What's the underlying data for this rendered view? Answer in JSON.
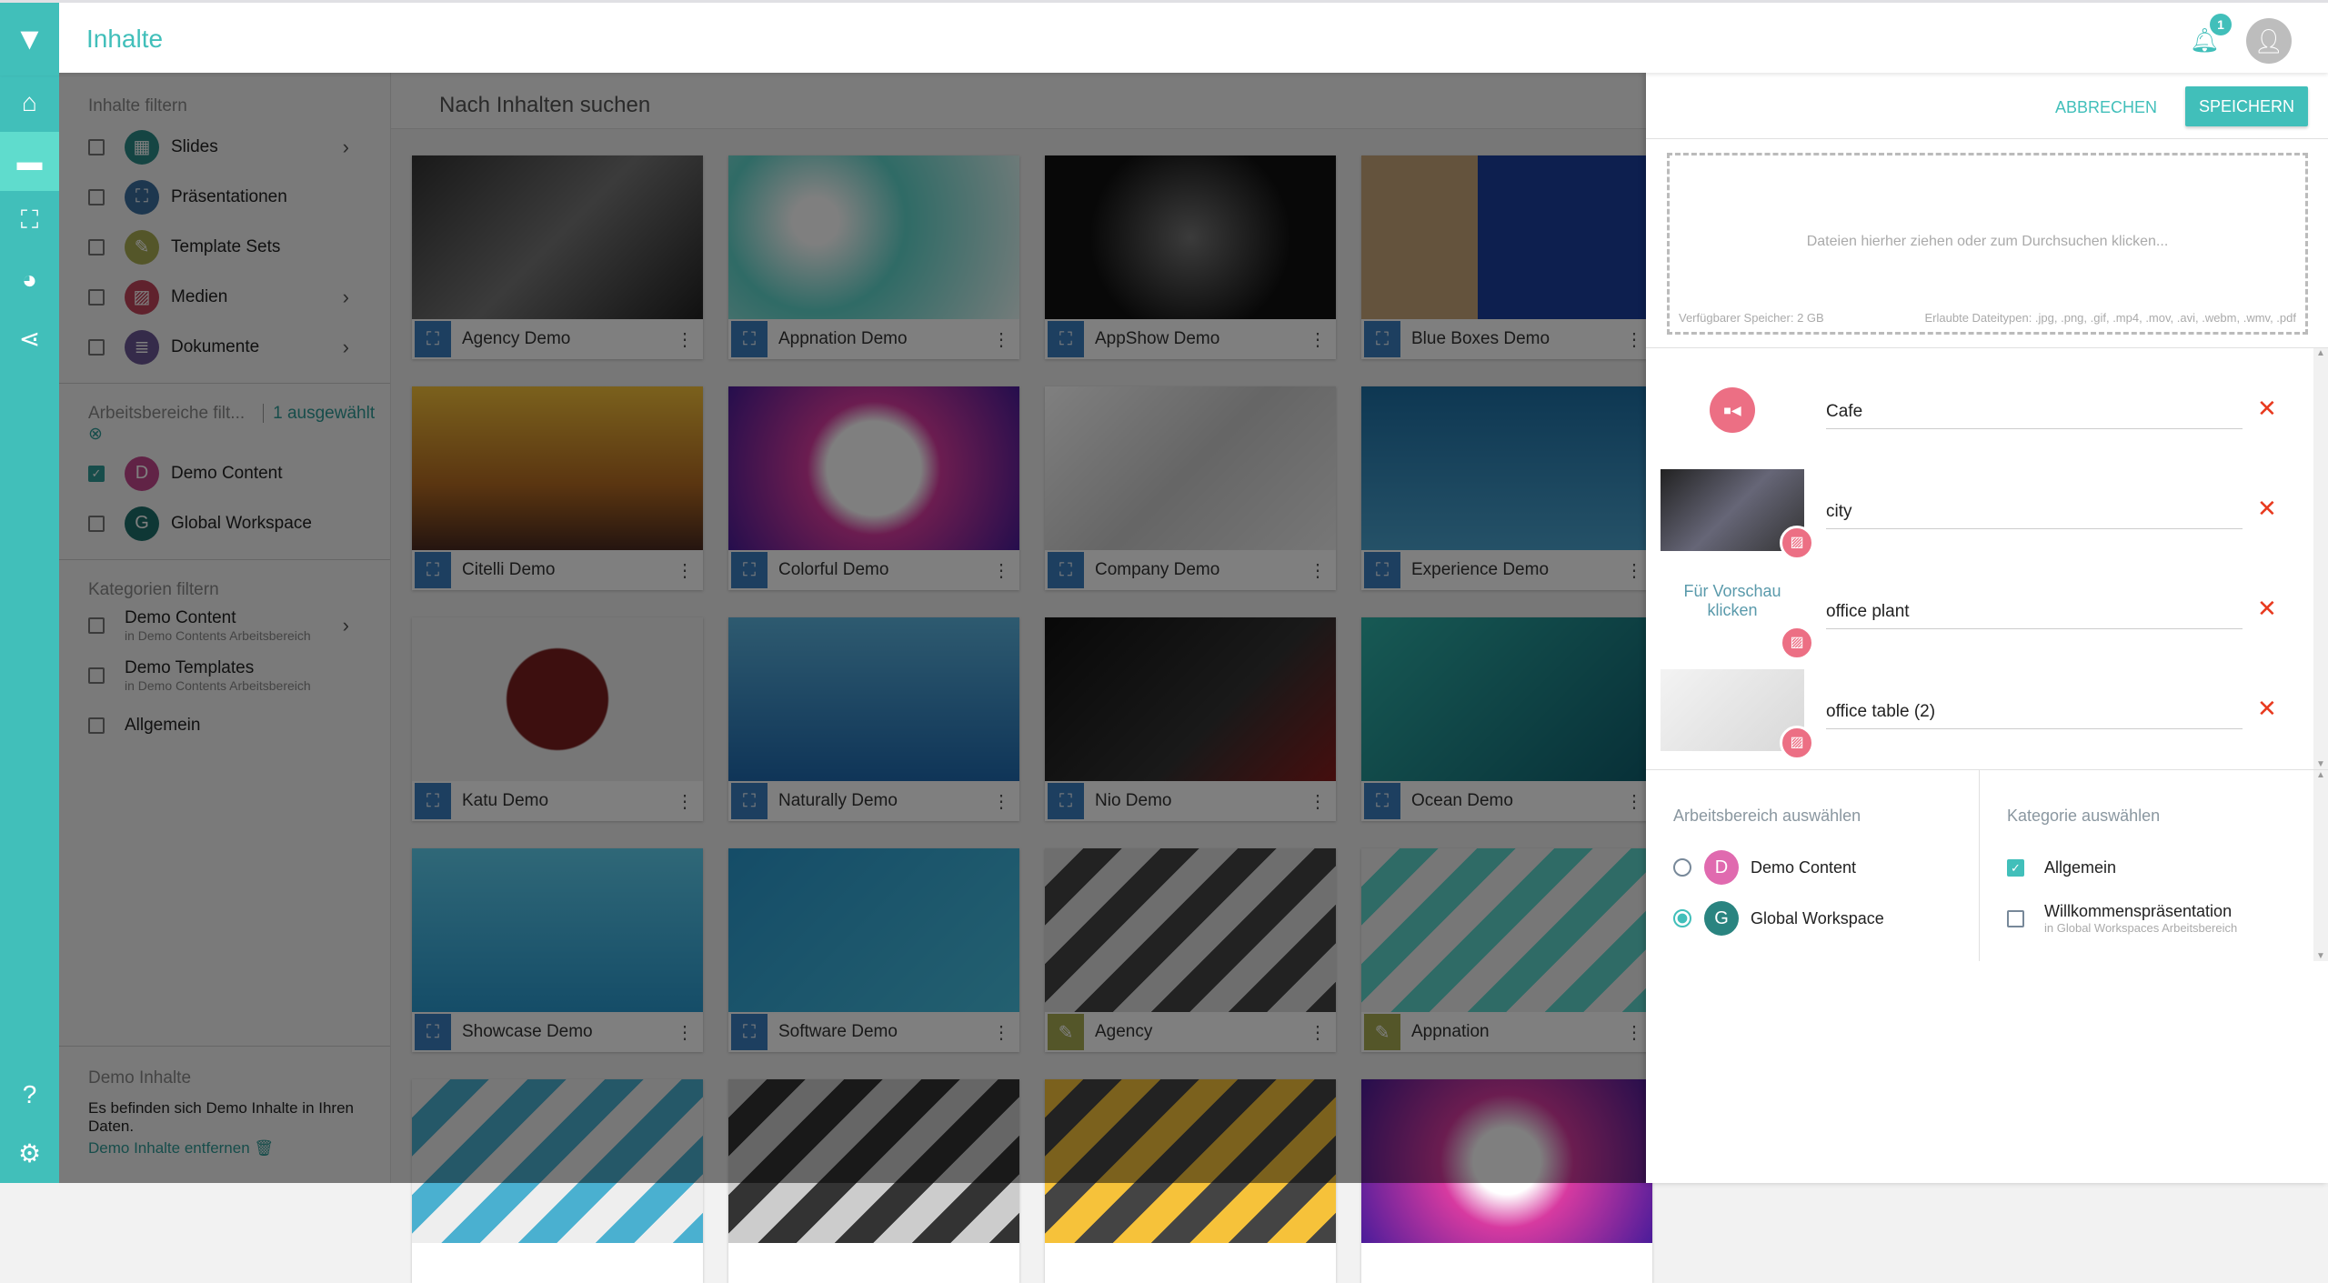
{
  "header": {
    "title": "Inhalte",
    "notification_count": "1"
  },
  "rail": [
    "home-icon",
    "folder-icon",
    "presentation-clock-icon",
    "pie-chart-icon",
    "share-clock-icon"
  ],
  "filters": {
    "content_title": "Inhalte filtern",
    "content_types": [
      {
        "label": "Slides",
        "color": "#2a8b87",
        "icon": "▦",
        "chevron": true
      },
      {
        "label": "Präsentationen",
        "color": "#3a6e9e",
        "icon": "⛶",
        "chevron": false
      },
      {
        "label": "Template Sets",
        "color": "#a9ad53",
        "icon": "✎",
        "chevron": false
      },
      {
        "label": "Medien",
        "color": "#c0455a",
        "icon": "▨",
        "chevron": true
      },
      {
        "label": "Dokumente",
        "color": "#6a5694",
        "icon": "≣",
        "chevron": true
      }
    ],
    "workspace_title": "Arbeitsbereiche filt...",
    "workspace_selected": "1 ausgewählt",
    "workspaces": [
      {
        "label": "Demo Content",
        "letter": "D",
        "color": "#c2478c",
        "checked": true
      },
      {
        "label": "Global Workspace",
        "letter": "G",
        "color": "#1d6e6a",
        "checked": false
      }
    ],
    "category_title": "Kategorien filtern",
    "categories": [
      {
        "label": "Demo Content",
        "sub": "in Demo Contents Arbeitsbereich",
        "chevron": true
      },
      {
        "label": "Demo Templates",
        "sub": "in Demo Contents Arbeitsbereich",
        "chevron": false
      },
      {
        "label": "Allgemein",
        "sub": "",
        "chevron": false
      }
    ],
    "demo_title": "Demo Inhalte",
    "demo_text": "Es befinden sich Demo Inhalte in Ihren Daten.",
    "demo_remove": "Demo Inhalte entfernen"
  },
  "search": {
    "placeholder": "Nach Inhalten suchen"
  },
  "cards": [
    {
      "name": "Agency Demo",
      "type": "presentation",
      "bg": "linear-gradient(135deg,#333,#777 50%,#222)"
    },
    {
      "name": "Appnation Demo",
      "type": "presentation",
      "bg": "radial-gradient(circle at 30% 40%,#fff 10%,#5fd6cc 40%,#e8f8f6)"
    },
    {
      "name": "AppShow Demo",
      "type": "presentation",
      "bg": "radial-gradient(circle,#777,#111 60%)"
    },
    {
      "name": "Blue Boxes Demo",
      "type": "presentation",
      "bg": "linear-gradient(90deg,#c9a77a 40%,#1a3f9e 40%)"
    },
    {
      "name": "Citelli Demo",
      "type": "presentation",
      "bg": "linear-gradient(180deg,#f6c23a,#b56b22 60%,#4a2a20)"
    },
    {
      "name": "Colorful Demo",
      "type": "presentation",
      "bg": "radial-gradient(circle,#fff 28%,#d73aa0 40%,#4a1c9a)"
    },
    {
      "name": "Company Demo",
      "type": "presentation",
      "bg": "linear-gradient(135deg,#fff,#ccc 50%,#eee)"
    },
    {
      "name": "Experience Demo",
      "type": "presentation",
      "bg": "linear-gradient(180deg,#1c6fa5,#4aa3cf)"
    },
    {
      "name": "Katu Demo",
      "type": "presentation",
      "bg": "radial-gradient(circle,#7a1f1f 30%,#eee 31%)"
    },
    {
      "name": "Naturally Demo",
      "type": "presentation",
      "bg": "linear-gradient(180deg,#5cb5e0,#1f6ab0)"
    },
    {
      "name": "Nio Demo",
      "type": "presentation",
      "bg": "linear-gradient(135deg,#111,#333 60%,#8a1c1c)"
    },
    {
      "name": "Ocean Demo",
      "type": "presentation",
      "bg": "linear-gradient(135deg,#2fb3a9,#0f5f6f)"
    },
    {
      "name": "Showcase Demo",
      "type": "presentation",
      "bg": "linear-gradient(180deg,#5fd0f0,#2a9ad0)"
    },
    {
      "name": "Software Demo",
      "type": "presentation",
      "bg": "linear-gradient(135deg,#2a9ad0,#47c0e0)"
    },
    {
      "name": "Agency",
      "type": "template",
      "bg": "repeating-linear-gradient(135deg,#ddd 0 30px,#444 30px 60px)"
    },
    {
      "name": "Appnation",
      "type": "template",
      "bg": "repeating-linear-gradient(135deg,#eee 0 30px,#5fd6cc 30px 60px)"
    },
    {
      "name": "",
      "type": "",
      "bg": "repeating-linear-gradient(135deg,#eee 0 30px,#4ab0d0 30px 60px)"
    },
    {
      "name": "",
      "type": "",
      "bg": "repeating-linear-gradient(135deg,#ccc 0 30px,#333 30px 60px)"
    },
    {
      "name": "",
      "type": "",
      "bg": "repeating-linear-gradient(135deg,#f6c23a 0 30px,#444 30px 60px)"
    },
    {
      "name": "",
      "type": "",
      "bg": "radial-gradient(circle,#fff 20%,#d73aa0 40%,#4a1c9a)"
    }
  ],
  "panel": {
    "cancel": "ABBRECHEN",
    "save": "SPEICHERN",
    "drop_text": "Dateien hierher ziehen oder zum Durchsuchen klicken...",
    "storage": "Verfügbarer Speicher: 2 GB",
    "types": "Erlaubte Dateitypen: .jpg, .png, .gif, .mp4, .mov, .avi, .webm, .wmv, .pdf",
    "uploads": [
      {
        "name": "Cafe",
        "kind": "video",
        "preview": ""
      },
      {
        "name": "city",
        "kind": "image",
        "preview": "linear-gradient(135deg,#222,#667 50%,#333)"
      },
      {
        "name": "office plant",
        "kind": "image",
        "preview": "",
        "preview_text": "Für Vorschau klicken"
      },
      {
        "name": "office table (2)",
        "kind": "image",
        "preview": "linear-gradient(135deg,#f3f3f3,#d8d8d8)"
      }
    ],
    "workspace_title": "Arbeitsbereich auswählen",
    "workspaces": [
      {
        "label": "Demo Content",
        "letter": "D",
        "color": "#e06aaf",
        "selected": false
      },
      {
        "label": "Global Workspace",
        "letter": "G",
        "color": "#2a8480",
        "selected": true
      }
    ],
    "category_title": "Kategorie auswählen",
    "categories": [
      {
        "label": "Allgemein",
        "sub": "",
        "checked": true
      },
      {
        "label": "Willkommenspräsentation",
        "sub": "in Global Workspaces Arbeitsbereich",
        "checked": false
      }
    ]
  },
  "colors": {
    "accent": "#41bfba",
    "delete": "#e8391e",
    "media": "#ec6f84"
  }
}
